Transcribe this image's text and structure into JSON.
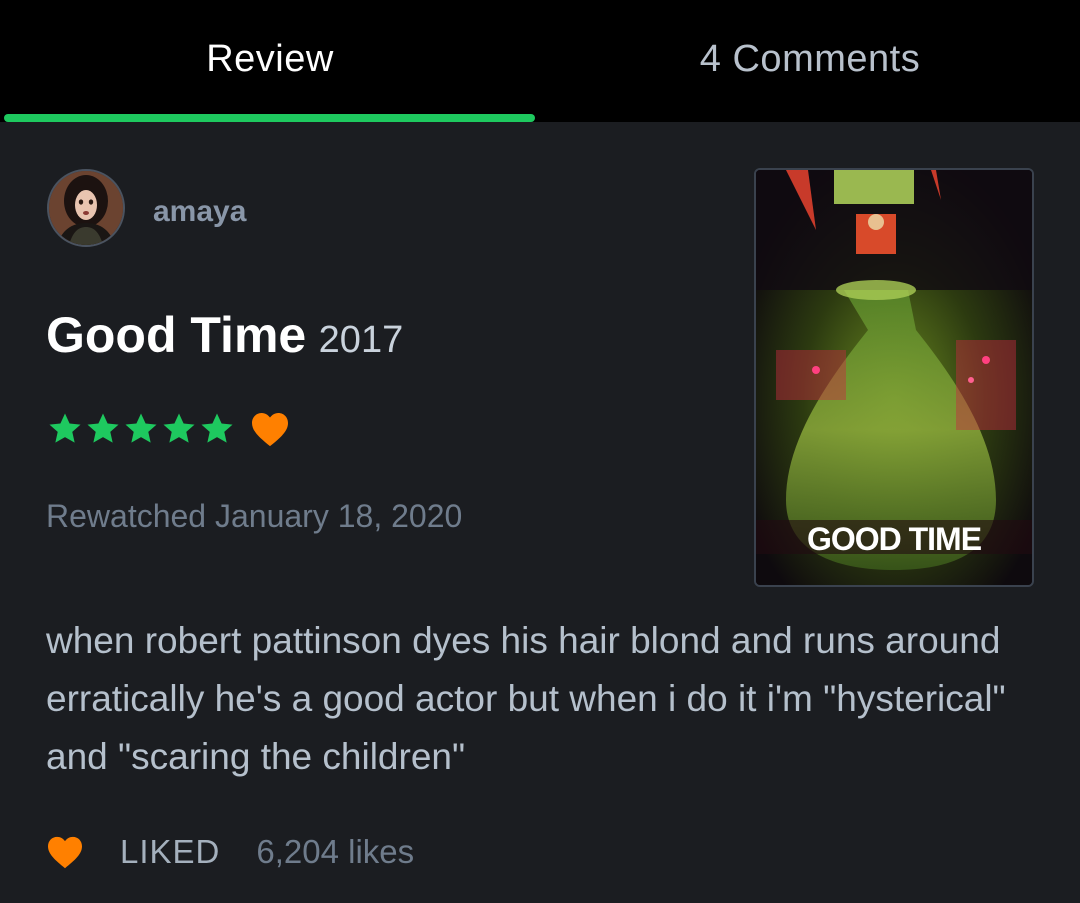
{
  "tabs": {
    "review_label": "Review",
    "comments_label": "4 Comments",
    "active": "Review",
    "accent_color": "#1ec95f"
  },
  "review": {
    "username": "amaya",
    "film_title": "Good Time",
    "film_year": "2017",
    "rating_stars": 5,
    "rating_max": 5,
    "liked_by_reviewer": true,
    "rewatched_text": "Rewatched January 18, 2020",
    "body": "when robert pattinson dyes his hair blond and runs around erratically he's a good actor but when i do it i'm \"hysterical\" and \"scaring the children\"",
    "poster_title_text": "GOOD TIME"
  },
  "footer": {
    "liked_label": "LIKED",
    "likes_count": "6,204 likes",
    "heart_color": "#ff8000"
  },
  "icons": {
    "star": "star-icon",
    "heart": "heart-icon"
  }
}
